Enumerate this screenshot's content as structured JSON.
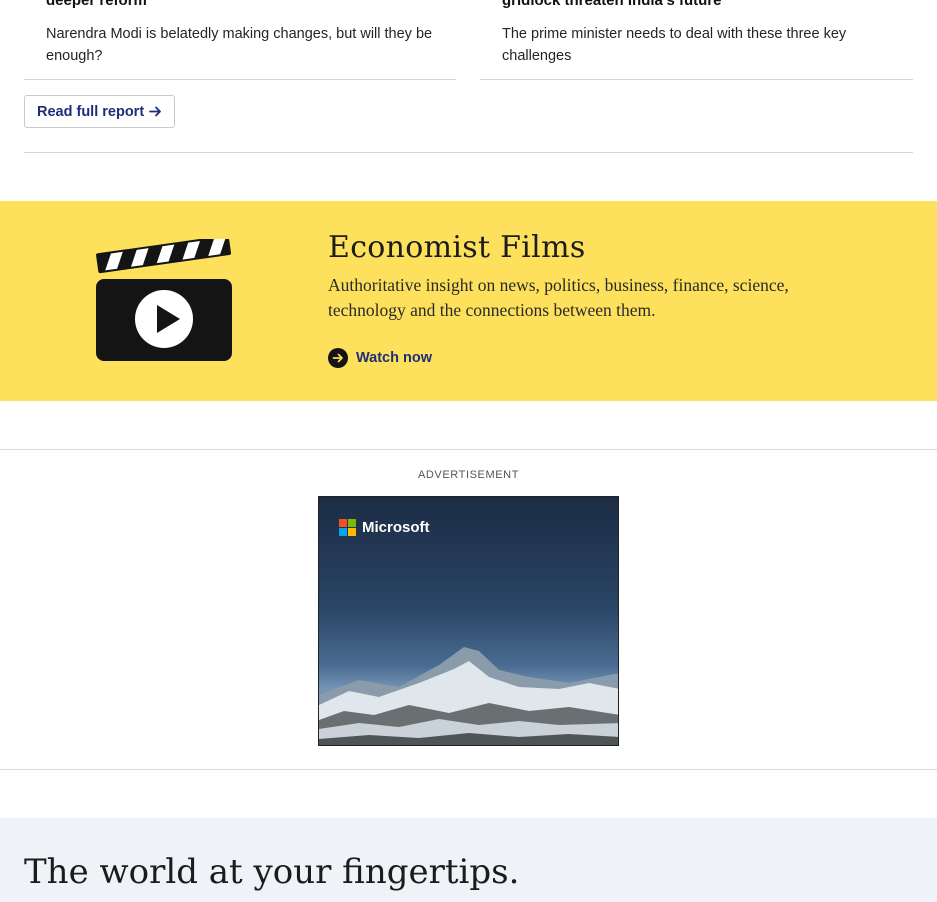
{
  "articles": [
    {
      "headline": "deeper reform",
      "summary": "Narendra Modi is belatedly making changes, but will they be enough?"
    },
    {
      "headline": "gridlock threaten India’s future",
      "summary": "The prime minister needs to deal with these three key challenges"
    }
  ],
  "read_full_report": {
    "label": "Read full report",
    "icon": "arrow-right-icon"
  },
  "films": {
    "title": "Economist Films",
    "description": "Authoritative insight on news, politics, business, finance, science, technology and the connections between them.",
    "watch_label": "Watch now",
    "icon": "clapperboard-play-icon",
    "background": "#fde05b"
  },
  "advertisement": {
    "label": "ADVERTISEMENT",
    "brand": "Microsoft"
  },
  "footer": {
    "tagline": "The world at your fingertips."
  },
  "colors": {
    "link": "#1f2e7a",
    "divider": "#d7d7d7",
    "footer_bg": "#eff2f7"
  }
}
